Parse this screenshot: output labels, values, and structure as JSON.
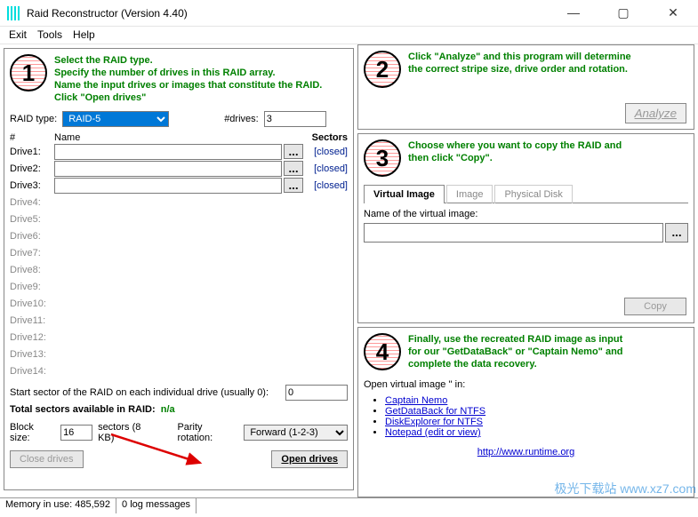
{
  "window": {
    "title": "Raid Reconstructor (Version 4.40)",
    "min": "—",
    "max": "▢",
    "close": "✕"
  },
  "menu": {
    "exit": "Exit",
    "tools": "Tools",
    "help": "Help"
  },
  "step1": {
    "num": "1",
    "l1": "Select the RAID type.",
    "l2": "Specify the number of drives in this RAID array.",
    "l3": "Name the input drives or images that constitute the RAID.",
    "l4": "Click \"Open drives\""
  },
  "raid": {
    "type_label": "RAID type:",
    "type_value": "RAID-5",
    "ndrives_label": "#drives:",
    "ndrives_value": "3",
    "hdr_num": "#",
    "hdr_name": "Name",
    "hdr_sectors": "Sectors",
    "drives": [
      {
        "label": "Drive1:",
        "enabled": true,
        "status": "[closed]"
      },
      {
        "label": "Drive2:",
        "enabled": true,
        "status": "[closed]"
      },
      {
        "label": "Drive3:",
        "enabled": true,
        "status": "[closed]"
      },
      {
        "label": "Drive4:",
        "enabled": false,
        "status": ""
      },
      {
        "label": "Drive5:",
        "enabled": false,
        "status": ""
      },
      {
        "label": "Drive6:",
        "enabled": false,
        "status": ""
      },
      {
        "label": "Drive7:",
        "enabled": false,
        "status": ""
      },
      {
        "label": "Drive8:",
        "enabled": false,
        "status": ""
      },
      {
        "label": "Drive9:",
        "enabled": false,
        "status": ""
      },
      {
        "label": "Drive10:",
        "enabled": false,
        "status": ""
      },
      {
        "label": "Drive11:",
        "enabled": false,
        "status": ""
      },
      {
        "label": "Drive12:",
        "enabled": false,
        "status": ""
      },
      {
        "label": "Drive13:",
        "enabled": false,
        "status": ""
      },
      {
        "label": "Drive14:",
        "enabled": false,
        "status": ""
      }
    ],
    "start_sector_label": "Start sector of the RAID on each individual drive (usually 0):",
    "start_sector_value": "0",
    "total_label": "Total sectors available in RAID:",
    "total_value": "n/a",
    "block_label": "Block size:",
    "block_value": "16",
    "block_unit": "sectors (8 KB)",
    "parity_label": "Parity rotation:",
    "parity_value": "Forward (1-2-3)",
    "close_drives": "Close drives",
    "open_drives": "Open drives"
  },
  "step2": {
    "num": "2",
    "l1": "Click \"Analyze\" and this program will determine",
    "l2": "the correct stripe size, drive order and rotation.",
    "analyze": "Analyze"
  },
  "step3": {
    "num": "3",
    "l1": "Choose where you want to copy the RAID and",
    "l2": "then click \"Copy\".",
    "tab_vi": "Virtual Image",
    "tab_img": "Image",
    "tab_phys": "Physical Disk",
    "name_label": "Name of the virtual image:",
    "browse": "...",
    "copy": "Copy"
  },
  "step4": {
    "num": "4",
    "l1": "Finally, use the recreated RAID image as input",
    "l2": "for our \"GetDataBack\" or \"Captain Nemo\" and",
    "l3": "complete the data recovery.",
    "open_label": "Open virtual image '' in:",
    "links": [
      "Captain Nemo",
      "GetDataBack for NTFS",
      "DiskExplorer for NTFS",
      "Notepad (edit or view)"
    ],
    "site": "http://www.runtime.org"
  },
  "status": {
    "mem": "Memory in use: 485,592",
    "log": "0 log messages"
  },
  "watermark": "极光下载站  www.xz7.com"
}
